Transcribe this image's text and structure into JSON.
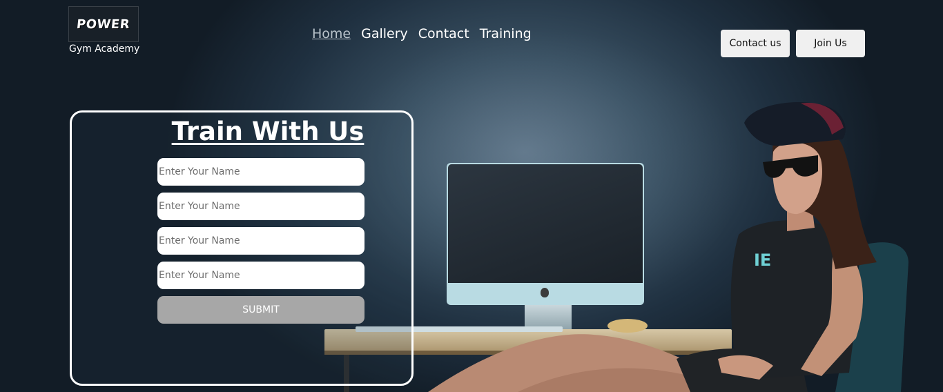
{
  "brand": {
    "logo_text": "POWER",
    "subtitle": "Gym Academy"
  },
  "nav": {
    "items": [
      {
        "label": "Home",
        "active": true
      },
      {
        "label": "Gallery",
        "active": false
      },
      {
        "label": "Contact",
        "active": false
      },
      {
        "label": "Training",
        "active": false
      }
    ]
  },
  "header_buttons": {
    "contact_label": "Contact us",
    "join_label": "Join Us"
  },
  "form": {
    "title": "Train With Us",
    "fields": [
      {
        "placeholder": "Enter Your Name",
        "value": ""
      },
      {
        "placeholder": "Enter Your Name",
        "value": ""
      },
      {
        "placeholder": "Enter Your Name",
        "value": ""
      },
      {
        "placeholder": "Enter Your Name",
        "value": ""
      }
    ],
    "submit_label": "SUBMIT"
  },
  "hero_image": {
    "shirt_text": "IE"
  },
  "colors": {
    "background": "#1f3040",
    "button_bg": "#f0f0f0",
    "submit_bg": "#a7a7a7",
    "nav_active": "#b9c3cb"
  }
}
